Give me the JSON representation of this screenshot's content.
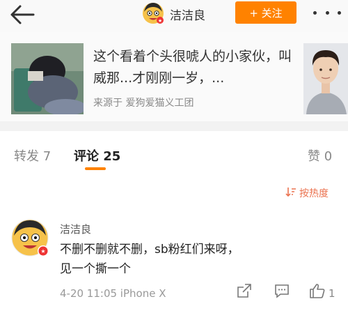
{
  "header": {
    "username": "洁洁良",
    "follow_label": "+ 关注",
    "back_icon": "back-arrow-icon",
    "more_icon": "more-dots-icon"
  },
  "shared_card": {
    "title": "这个看着个头很唬人的小家伙，叫威那...才刚刚一岁，...",
    "source": "来源于 爱狗爱猫义工团"
  },
  "tabs": {
    "repost": "转发 7",
    "comments": "评论 25",
    "likes": "赞 0"
  },
  "sort": {
    "label": "按热度",
    "icon": "sort-icon"
  },
  "comment": {
    "author": "洁洁良",
    "text_line1": "不删不删就不删，sb粉红们来呀，",
    "text_line2": "见一个撕一个",
    "meta": "4-20 11:05  iPhone X",
    "like_count": "1"
  },
  "colors": {
    "accent": "#ff8200",
    "sort_text": "#eb7350"
  }
}
